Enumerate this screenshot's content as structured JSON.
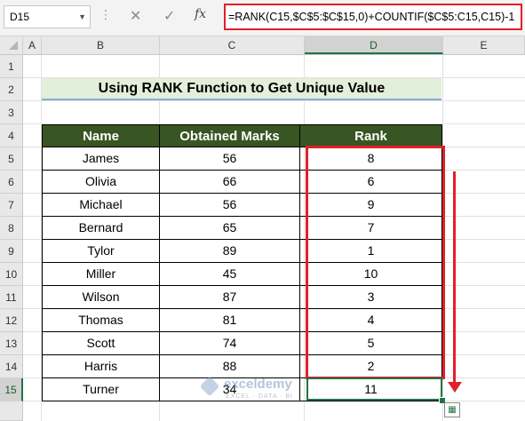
{
  "formula_bar": {
    "name_box": "D15",
    "fx_label": "fx",
    "formula": "=RANK(C15,$C$5:$C$15,0)+COUNTIF($C$5:C15,C15)-1"
  },
  "columns": [
    "A",
    "B",
    "C",
    "D",
    "E"
  ],
  "selected_column": "D",
  "rows": [
    "1",
    "2",
    "3",
    "4",
    "5",
    "6",
    "7",
    "8",
    "9",
    "10",
    "11",
    "12",
    "13",
    "14",
    "15"
  ],
  "selected_row": "15",
  "title": "Using RANK Function to Get Unique Value",
  "table": {
    "headers": [
      "Name",
      "Obtained Marks",
      "Rank"
    ],
    "rows": [
      [
        "James",
        "56",
        "8"
      ],
      [
        "Olivia",
        "66",
        "6"
      ],
      [
        "Michael",
        "56",
        "9"
      ],
      [
        "Bernard",
        "65",
        "7"
      ],
      [
        "Tylor",
        "89",
        "1"
      ],
      [
        "Miller",
        "45",
        "10"
      ],
      [
        "Wilson",
        "87",
        "3"
      ],
      [
        "Thomas",
        "81",
        "4"
      ],
      [
        "Scott",
        "74",
        "5"
      ],
      [
        "Harris",
        "88",
        "2"
      ],
      [
        "Turner",
        "34",
        "11"
      ]
    ]
  },
  "watermark": {
    "brand": "exceldemy",
    "tagline": "EXCEL · DATA · BI"
  },
  "colors": {
    "header_bg": "#375623",
    "title_bg": "#e2efda",
    "highlight": "#e0202a",
    "selection": "#217346"
  }
}
